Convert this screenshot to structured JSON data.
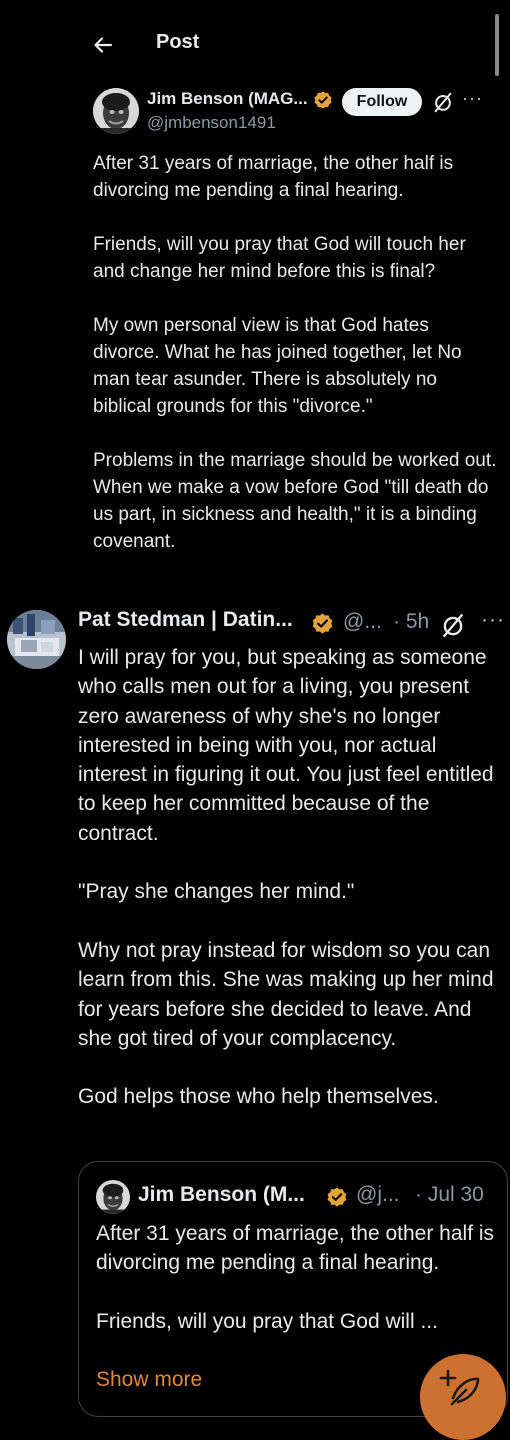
{
  "header": {
    "title": "Post"
  },
  "main_post": {
    "display_name": "Jim Benson (MAG...",
    "handle": "@jmbenson1491",
    "follow_label": "Follow",
    "more": "···",
    "paragraphs": [
      "After 31 years of marriage, the other half is divorcing me pending a final hearing.",
      "Friends, will you pray that God will touch her and change her mind before this is final?",
      "My own personal view is that God hates divorce. What he has joined together, let No man tear asunder. There is absolutely no biblical grounds for this \"divorce.\"",
      "Problems in the marriage should be worked out. When we make a vow before God \"till death do us part, in sickness and health,\" it is a binding covenant."
    ]
  },
  "reply": {
    "display_name": "Pat Stedman | Datin...",
    "handle": "@...",
    "time": "· 5h",
    "more": "···",
    "paragraphs": [
      "I will pray for you, but speaking as someone who calls men out for a living, you present zero awareness of why she's no longer interested in being with you, nor actual interest in figuring it out. You just feel entitled to keep her committed because of the contract.",
      "\"Pray she changes her mind.\"",
      "Why not pray instead for wisdom so you can learn from this. She was making up her mind for years before she decided to leave. And she got tired of your complacency.",
      "God helps those who help themselves."
    ]
  },
  "quote": {
    "display_name": "Jim Benson (M...",
    "handle": "@j...",
    "date": "· Jul 30",
    "paragraphs": [
      "After 31 years of marriage, the other half is divorcing me pending a final hearing.",
      "Friends, will you pray that God will ..."
    ],
    "show_more": "Show more"
  },
  "icons": {
    "back": "arrow-left-icon",
    "verified": "verified-badge-icon",
    "grok": "grok-icon",
    "compose": "compose-feather-icon"
  },
  "colors": {
    "background": "#000000",
    "text": "#e7e9ea",
    "secondary_text": "#8b98a5",
    "verified_gold": "#e2a33a",
    "accent_orange": "#e1873a",
    "fab": "#cd7131"
  }
}
